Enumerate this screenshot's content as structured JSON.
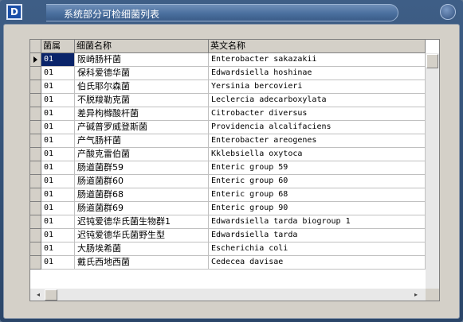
{
  "window": {
    "app_icon_letter": "D",
    "title": "系统部分可检细菌列表"
  },
  "grid": {
    "columns": [
      "菌属",
      "细菌名称",
      "英文名称"
    ],
    "selected_row": 0,
    "rows": [
      {
        "code": "01",
        "cn": "阪崎肠杆菌",
        "en": "Enterobacter sakazakii"
      },
      {
        "code": "01",
        "cn": "保科爱德华菌",
        "en": "Edwardsiella hoshinae"
      },
      {
        "code": "01",
        "cn": "伯氏耶尔森菌",
        "en": "Yersinia bercovieri"
      },
      {
        "code": "01",
        "cn": "不脱羧勒克菌",
        "en": "Leclercia adecarboxylata"
      },
      {
        "code": "01",
        "cn": "差异枸橼酸杆菌",
        "en": "Citrobacter diversus"
      },
      {
        "code": "01",
        "cn": "产碱普罗威登斯菌",
        "en": "Providencia alcalifaciens"
      },
      {
        "code": "01",
        "cn": "产气肠杆菌",
        "en": "Enterobacter areogenes"
      },
      {
        "code": "01",
        "cn": "产酸克雷伯菌",
        "en": "Kklebsiella oxytoca"
      },
      {
        "code": "01",
        "cn": "肠道菌群59",
        "en": "Enteric group 59"
      },
      {
        "code": "01",
        "cn": "肠道菌群60",
        "en": "Enteric group 60"
      },
      {
        "code": "01",
        "cn": "肠道菌群68",
        "en": "Enteric group 68"
      },
      {
        "code": "01",
        "cn": "肠道菌群69",
        "en": "Enteric group 90"
      },
      {
        "code": "01",
        "cn": "迟钝爱德华氏菌生物群1",
        "en": "Edwardsiella tarda biogroup 1"
      },
      {
        "code": "01",
        "cn": "迟钝爱德华氏菌野生型",
        "en": "Edwardsiella tarda"
      },
      {
        "code": "01",
        "cn": "大肠埃希菌",
        "en": "Escherichia coli"
      },
      {
        "code": "01",
        "cn": "戴氏西地西菌",
        "en": "Cedecea davisae"
      }
    ]
  },
  "scrollbar": {
    "left_arrow": "◂",
    "right_arrow": "▸"
  }
}
